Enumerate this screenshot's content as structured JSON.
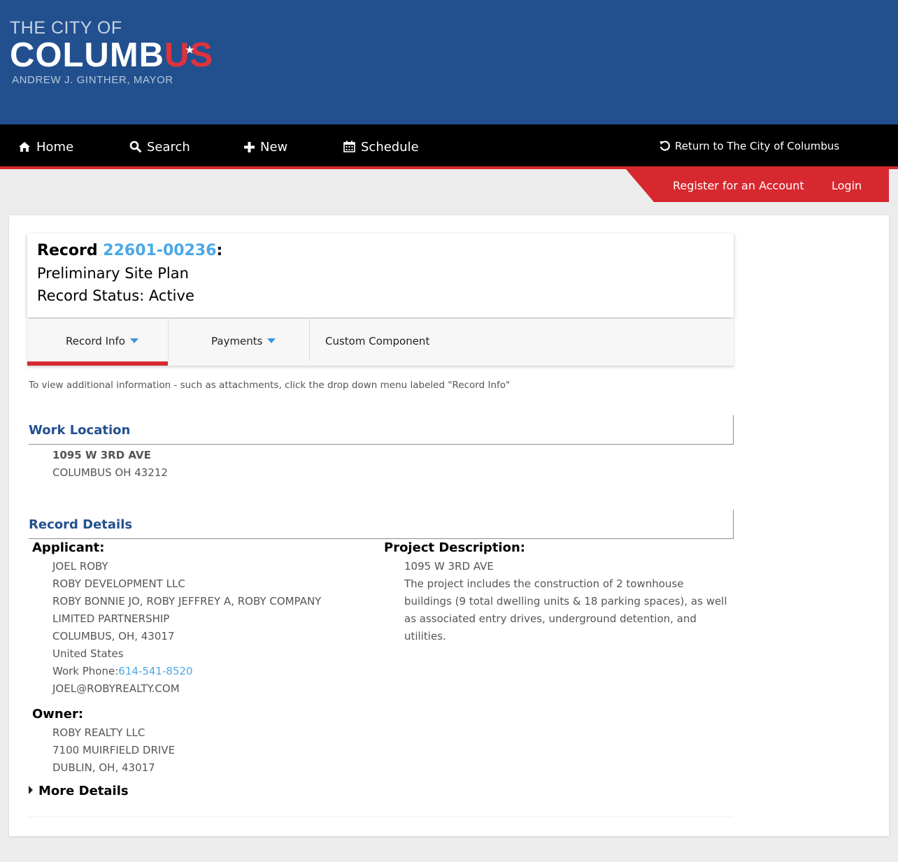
{
  "brand": {
    "line1": "THE CITY OF",
    "line2_white": "COLUMB",
    "line2_red": "US",
    "line3": "ANDREW J. GINTHER, MAYOR",
    "star": "★"
  },
  "nav": {
    "home": "Home",
    "search": "Search",
    "new": "New",
    "schedule": "Schedule",
    "return": "Return to The City of Columbus"
  },
  "account": {
    "register": "Register for an Account",
    "login": "Login"
  },
  "record": {
    "label": "Record",
    "number": "22601-00236",
    "colon": ":",
    "type": "Preliminary Site Plan",
    "status": "Record Status: Active"
  },
  "tabs": [
    {
      "label": "Record Info",
      "active": true
    },
    {
      "label": "Payments",
      "active": false
    },
    {
      "label": "Custom Component",
      "active": false
    }
  ],
  "hint": "To view additional information - such as attachments, click the drop down menu labeled \"Record Info\"",
  "work_location": {
    "title": "Work Location",
    "line1": "1095 W 3RD AVE",
    "line2": "COLUMBUS OH 43212"
  },
  "record_details": {
    "title": "Record Details",
    "applicant_label": "Applicant:",
    "applicant": {
      "name": "JOEL ROBY",
      "company": "ROBY DEVELOPMENT LLC",
      "org_line1": "ROBY BONNIE JO, ROBY JEFFREY A, ROBY COMPANY",
      "org_line2": "LIMITED PARTNERSHIP",
      "city": "COLUMBUS, OH, 43017",
      "country": "United States",
      "phone_label": "Work Phone:",
      "phone": "614-541-8520",
      "email": "JOEL@ROBYREALTY.COM"
    },
    "owner_label": "Owner:",
    "owner": {
      "name": "ROBY REALTY LLC",
      "street": "7100 MUIRFIELD DRIVE",
      "city": "DUBLIN, OH, 43017"
    },
    "project_label": "Project Description:",
    "project_address": "1095 W 3RD AVE",
    "project_text": "The project includes the construction of 2 townhouse buildings (9 total dwelling units & 18 parking spaces), as well as associated entry drives, underground detention, and utilities.",
    "more_details": "More Details"
  },
  "colors": {
    "banner": "#22508f",
    "nav": "#000000",
    "accent_red": "#d8282f",
    "link_blue": "#4aa8e8",
    "section_blue": "#22508f"
  },
  "icons": [
    "home-icon",
    "search-icon",
    "plus-icon",
    "calendar-icon",
    "refresh-icon",
    "caret-down-icon",
    "caret-right-icon"
  ]
}
